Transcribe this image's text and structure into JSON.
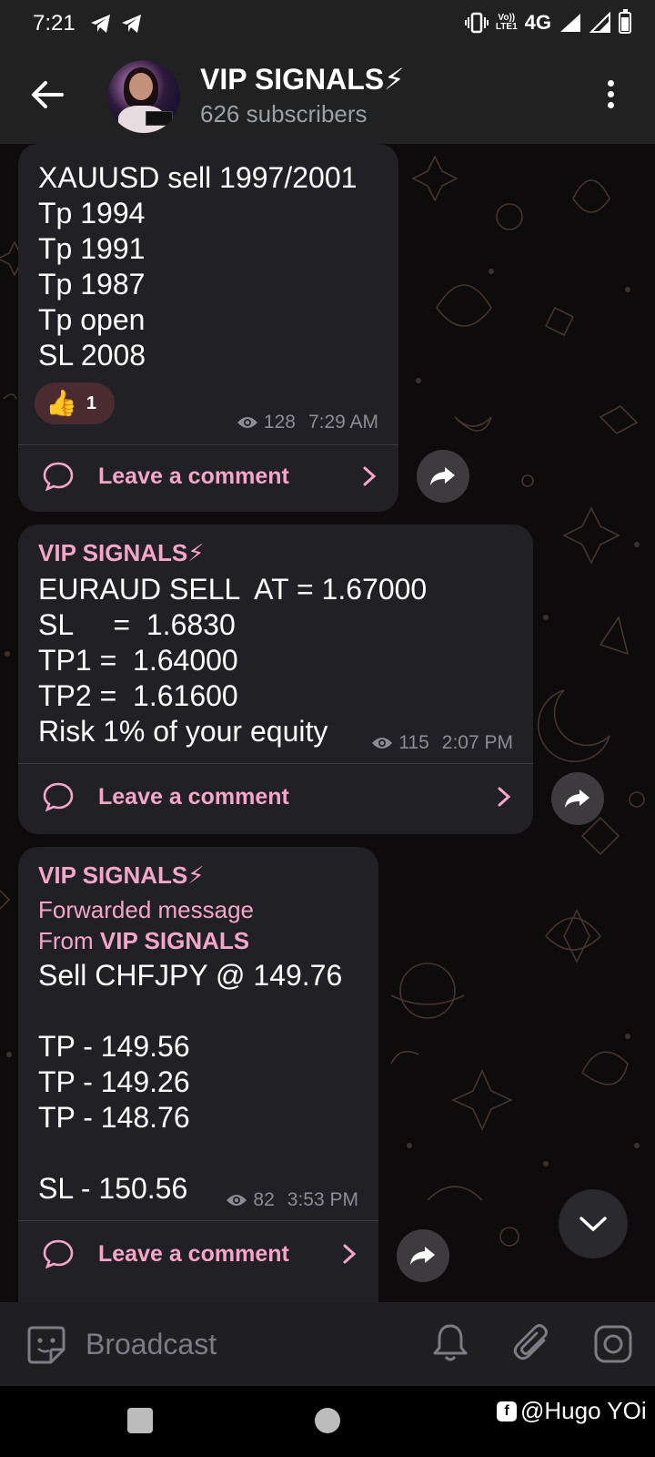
{
  "status_bar": {
    "time": "7:21",
    "network_label": "4G",
    "volte_top": "Vo))",
    "volte_bottom": "LTE1"
  },
  "header": {
    "channel_name": "VIP SIGNALS⚡",
    "subscribers": "626 subscribers"
  },
  "messages": [
    {
      "text": "XAUUSD sell 1997/2001\nTp 1994\nTp 1991\nTp 1987\nTp open\nSL 2008",
      "reaction": {
        "emoji": "👍",
        "count": "1"
      },
      "views": "128",
      "time": "7:29 AM",
      "comment_label": "Leave a comment"
    },
    {
      "author": "VIP SIGNALS⚡",
      "text": "EURAUD SELL  AT = 1.67000\nSL     =  1.6830\nTP1 =  1.64000\nTP2 =  1.61600\nRisk 1% of your equity",
      "views": "115",
      "time": "2:07 PM",
      "comment_label": "Leave a comment"
    },
    {
      "author": "VIP SIGNALS⚡",
      "forwarded_label": "Forwarded message",
      "forwarded_from_prefix": "From ",
      "forwarded_from": "VIP SIGNALS",
      "text": "Sell CHFJPY @ 149.76\n\nTP - 149.56\nTP - 149.26\nTP - 148.76\n\nSL - 150.56",
      "views": "82",
      "time": "3:53 PM",
      "comment_label": "Leave a comment"
    }
  ],
  "input": {
    "placeholder": "Broadcast"
  },
  "watermark": {
    "text": "@Hugo YOi"
  },
  "colors": {
    "accent_pink": "#f3a6c8",
    "bubble": "#212024",
    "header": "#212121"
  }
}
